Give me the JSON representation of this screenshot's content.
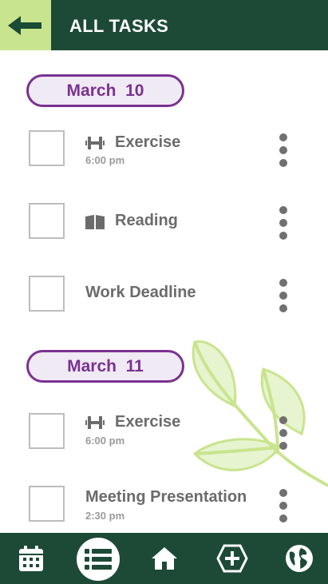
{
  "header": {
    "title": "ALL TASKS",
    "back_icon": "arrow-left-icon",
    "accent": "#c9e48e",
    "bg": "#1d4a36"
  },
  "groups": [
    {
      "date": "March  10",
      "tasks": [
        {
          "title": "Exercise",
          "time": "6:00 pm",
          "icon": "dumbbell-icon"
        },
        {
          "title": "Reading",
          "time": "",
          "icon": "book-icon"
        },
        {
          "title": "Work Deadline",
          "time": "",
          "icon": ""
        }
      ]
    },
    {
      "date": "March  11",
      "tasks": [
        {
          "title": "Exercise",
          "time": "6:00 pm",
          "icon": "dumbbell-icon"
        },
        {
          "title": "Meeting Presentation",
          "time": "2:30 pm",
          "icon": ""
        }
      ]
    }
  ],
  "nav": {
    "items": [
      "calendar-icon",
      "list-icon",
      "home-icon",
      "add-hexagon-icon",
      "globe-icon"
    ],
    "active": "list-icon"
  },
  "colors": {
    "date_accent": "#7a3291",
    "pill_bg": "#efeaf4",
    "leaf": "#c9e48e"
  }
}
